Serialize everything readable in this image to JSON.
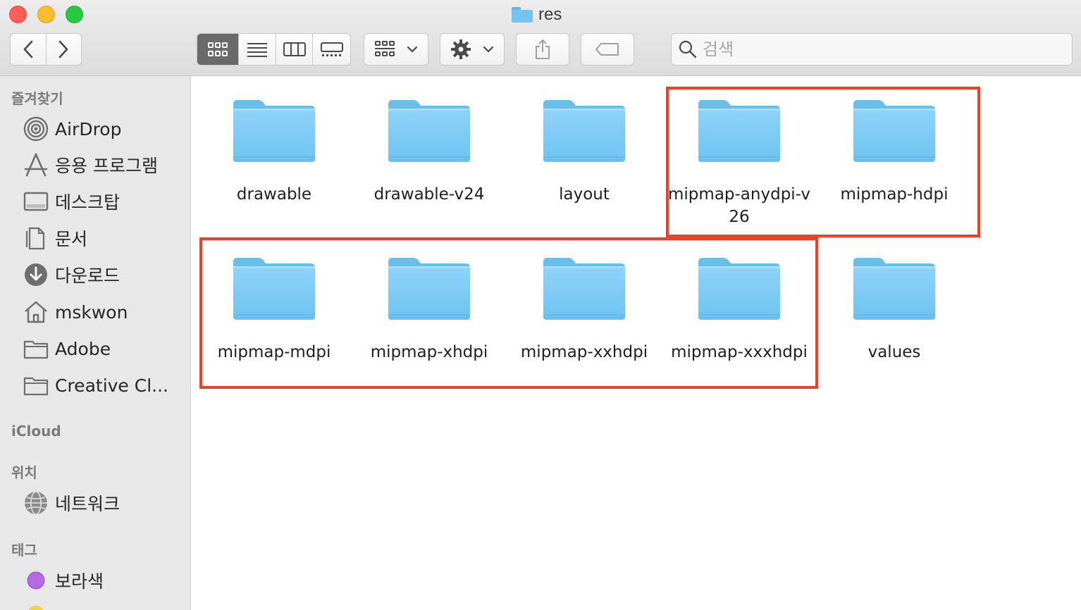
{
  "window": {
    "title": "res"
  },
  "toolbar": {
    "back_icon": "chevron-left-icon",
    "forward_icon": "chevron-right-icon",
    "view_modes": [
      "icon-view",
      "list-view",
      "column-view",
      "gallery-view"
    ],
    "active_view": "icon-view",
    "group_icon": "group-grid-icon",
    "action_icon": "gear-icon",
    "share_icon": "share-icon",
    "tag_icon": "tag-icon"
  },
  "search": {
    "placeholder": "검색",
    "value": ""
  },
  "sidebar": {
    "favorites_title": "즐겨찾기",
    "favorites": [
      {
        "label": "AirDrop",
        "icon": "airdrop-icon"
      },
      {
        "label": "응용 프로그램",
        "icon": "applications-icon"
      },
      {
        "label": "데스크탑",
        "icon": "desktop-icon"
      },
      {
        "label": "문서",
        "icon": "document-icon"
      },
      {
        "label": "다운로드",
        "icon": "download-icon"
      },
      {
        "label": "mskwon",
        "icon": "home-icon"
      },
      {
        "label": "Adobe",
        "icon": "folder-icon"
      },
      {
        "label": "Creative Cl...",
        "icon": "folder-icon"
      }
    ],
    "icloud_title": "iCloud",
    "locations_title": "위치",
    "locations": [
      {
        "label": "네트워크",
        "icon": "network-icon"
      }
    ],
    "tags_title": "태그",
    "tags": [
      {
        "label": "보라색",
        "color": "#b36ae2"
      }
    ]
  },
  "folders": [
    {
      "name": "drawable"
    },
    {
      "name": "drawable-v24"
    },
    {
      "name": "layout"
    },
    {
      "name": "mipmap-anydpi-v26"
    },
    {
      "name": "mipmap-hdpi"
    },
    {
      "name": "mipmap-mdpi"
    },
    {
      "name": "mipmap-xhdpi"
    },
    {
      "name": "mipmap-xxhdpi"
    },
    {
      "name": "mipmap-xxxhdpi"
    },
    {
      "name": "values"
    }
  ],
  "colors": {
    "highlight": "#e8412c",
    "folder": "#7ccbf5",
    "sidebar_bg": "#e8e8e8"
  }
}
